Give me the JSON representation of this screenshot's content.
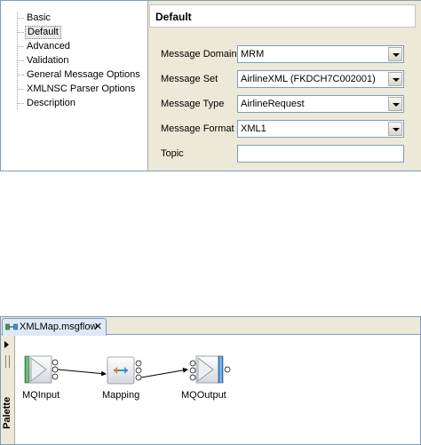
{
  "properties": {
    "tree_items": [
      "Basic",
      "Default",
      "Advanced",
      "Validation",
      "General Message Options",
      "XMLNSC Parser Options",
      "Description"
    ],
    "selected_index": 1,
    "section_title": "Default",
    "fields": {
      "message_domain": {
        "label": "Message Domain",
        "value": "MRM"
      },
      "message_set": {
        "label": "Message Set",
        "value": "AirlineXML (FKDCH7C002001)"
      },
      "message_type": {
        "label": "Message Type",
        "value": "AirlineRequest"
      },
      "message_format": {
        "label": "Message Format",
        "value": "XML1"
      },
      "topic": {
        "label": "Topic",
        "value": ""
      }
    }
  },
  "editor": {
    "tab_label": "XMLMap.msgflow",
    "tab_close": "✕",
    "palette_label": "Palette",
    "nodes": {
      "mqinput": "MQInput",
      "mapping": "Mapping",
      "mqoutput": "MQOutput"
    }
  },
  "colors": {
    "panel_bg": "#ece9d8",
    "border": "#7f9db9",
    "tab_bg": "#dfe8f6",
    "node_green": "#3f9f4f",
    "node_blue": "#3b8fd6",
    "mapping_orange": "#e8801a"
  }
}
